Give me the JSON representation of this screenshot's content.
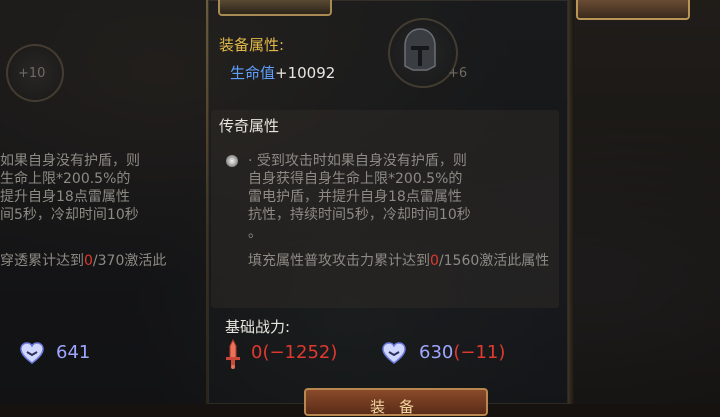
{
  "left_panel": {
    "top_badge": "+10",
    "legend_description": "如果自身没有护盾，则\n生命上限*200.5%的\n提升自身18点雷属性\n间5秒，冷却时间10秒",
    "activation": {
      "prefix": "穿透累计达到",
      "current": "0",
      "suffix": "/370激活此"
    },
    "power_value": "641"
  },
  "center_panel": {
    "equip_attr_title": "装备属性:",
    "hp_label": "生命值",
    "hp_value": "+10092",
    "helmet_badge": "+6",
    "legend_title": "传奇属性",
    "legend_description": "· 受到攻击时如果自身没有护盾，则\n自身获得自身生命上限*200.5%的\n雷电护盾，并提升自身18点雷属性\n抗性，持续时间5秒，冷却时间10秒\n。",
    "activation": {
      "prefix": "填充属性普攻攻击力累计达到",
      "current": "0",
      "suffix": "/1560激活此属性"
    },
    "base_power_label": "基础战力:",
    "attack_power": {
      "value": "0",
      "delta": "(−1252)"
    },
    "defense_power": {
      "value": "630",
      "delta": "(−11)"
    },
    "equip_button": "装备"
  },
  "icons": {
    "attack": "sword-icon",
    "defense": "heart-wings-icon",
    "helmet": "helmet-icon"
  },
  "colors": {
    "gold": "#e2b84a",
    "attr_blue": "#5ea0ff",
    "value_red": "#e0392f",
    "power_blue": "#9fa6ff"
  }
}
